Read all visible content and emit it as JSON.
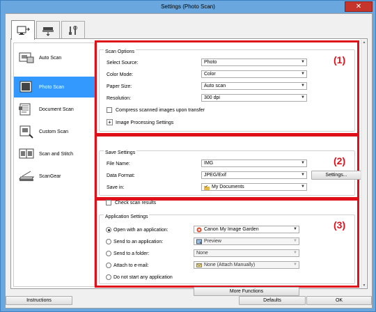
{
  "window": {
    "title": "Settings (Photo Scan)",
    "close_glyph": "✕"
  },
  "tabs": [
    {
      "name": "scan-from-computer-tab",
      "icon": "computer-scan-icon"
    },
    {
      "name": "scan-from-panel-tab",
      "icon": "scanner-panel-icon"
    },
    {
      "name": "general-settings-tab",
      "icon": "tools-icon"
    }
  ],
  "sidebar": {
    "items": [
      {
        "label": "Auto Scan",
        "icon": "auto-scan-icon"
      },
      {
        "label": "Photo Scan",
        "icon": "photo-scan-icon"
      },
      {
        "label": "Document Scan",
        "icon": "document-scan-icon"
      },
      {
        "label": "Custom Scan",
        "icon": "custom-scan-icon"
      },
      {
        "label": "Scan and Stitch",
        "icon": "scan-stitch-icon"
      },
      {
        "label": "ScanGear",
        "icon": "scangear-icon"
      }
    ]
  },
  "scan_options": {
    "title": "Scan Options",
    "marker": "(1)",
    "select_source_label": "Select Source:",
    "select_source_value": "Photo",
    "color_mode_label": "Color Mode:",
    "color_mode_value": "Color",
    "paper_size_label": "Paper Size:",
    "paper_size_value": "Auto scan",
    "resolution_label": "Resolution:",
    "resolution_value": "300 dpi",
    "compress_label": "Compress scanned images upon transfer",
    "image_processing_label": "Image Processing Settings",
    "plus_glyph": "+"
  },
  "save_settings": {
    "title": "Save Settings",
    "marker": "(2)",
    "file_name_label": "File Name:",
    "file_name_value": "IMG",
    "data_format_label": "Data Format:",
    "data_format_value": "JPEG/Exif",
    "settings_button": "Settings...",
    "save_in_label": "Save in:",
    "save_in_value": "My Documents",
    "check_results_label": "Check scan results"
  },
  "application_settings": {
    "title": "Application Settings",
    "marker": "(3)",
    "open_with_label": "Open with an application:",
    "open_with_value": "Canon My Image Garden",
    "send_app_label": "Send to an application:",
    "send_app_value": "Preview",
    "send_folder_label": "Send to a folder:",
    "send_folder_value": "None",
    "attach_email_label": "Attach to e-mail:",
    "attach_email_value": "None (Attach Manually)",
    "no_app_label": "Do not start any application",
    "more_functions_button": "More Functions"
  },
  "footer": {
    "instructions_button": "Instructions",
    "defaults_button": "Defaults",
    "ok_button": "OK"
  },
  "colors": {
    "title_bg": "#6aa7de",
    "highlight": "#e0101a",
    "selected_item": "#3399ff"
  }
}
